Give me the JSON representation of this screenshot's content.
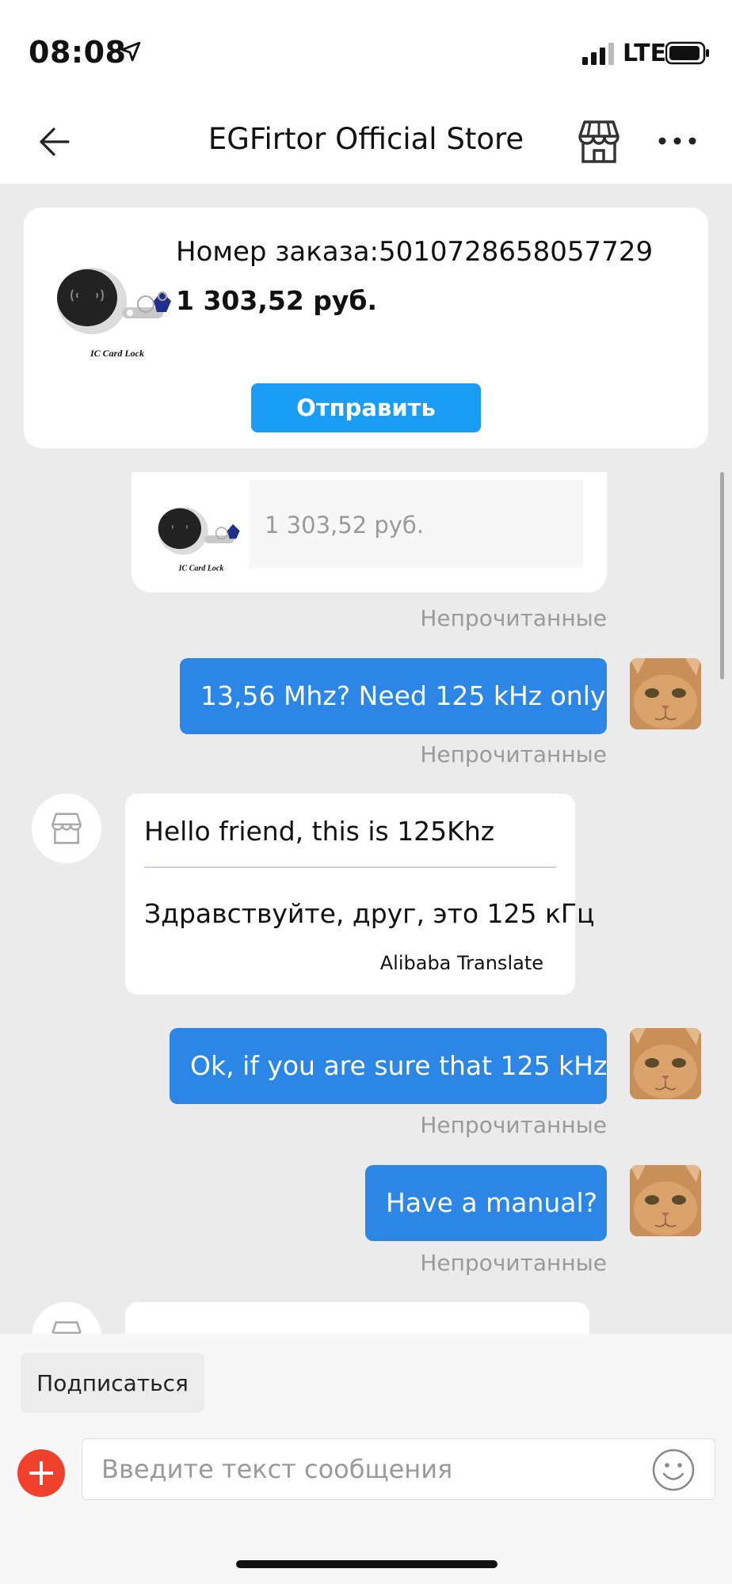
{
  "status_bar": {
    "time": "08:08",
    "network": "LTE"
  },
  "header": {
    "title": "EGFirtor Official Store"
  },
  "order_card": {
    "order_number": "Номер заказа:5010728658057729",
    "price": "1 303,52 руб.",
    "send_label": "Отправить",
    "product_caption": "IC Card Lock"
  },
  "chat": {
    "product_bubble": {
      "price": "1 303,52 руб.",
      "caption": "IC Card Lock"
    },
    "unread_label": "Непрочитанные",
    "messages": [
      {
        "text": "13,56 Mhz? Need 125 kHz only"
      },
      {
        "original": "Hello friend, this is 125Khz",
        "translated": "Здравствуйте, друг, это 125 кГц",
        "translation_provider": "Alibaba Translate"
      },
      {
        "text": "Ok, if you are sure that 125 kHz"
      },
      {
        "text": "Have a manual?"
      }
    ]
  },
  "footer": {
    "subscribe_label": "Подписаться",
    "input_placeholder": "Введите текст сообщения"
  },
  "colors": {
    "accent_blue": "#1a9df5",
    "outgoing_bubble": "#2b86e6",
    "plus_red": "#f0412c"
  }
}
